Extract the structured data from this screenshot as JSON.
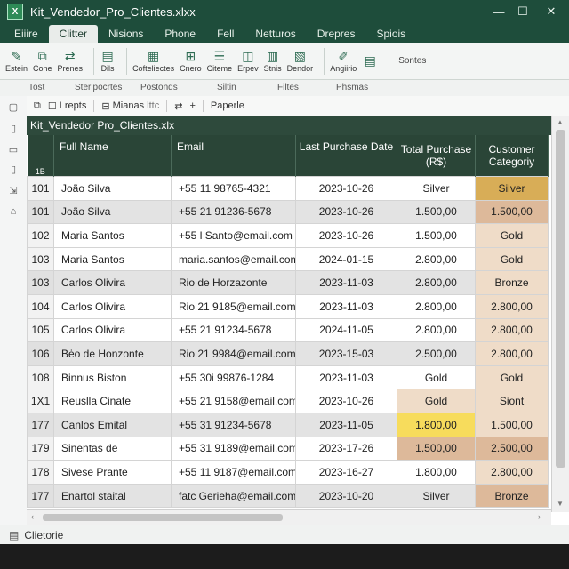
{
  "window": {
    "title": "Kit_Vendedor_Pro_Clientes.xlxx",
    "app_icon_letter": "X",
    "minimize": "—",
    "maximize": "☐",
    "close": "✕"
  },
  "menu_tabs": [
    "Eiiire",
    "Clitter",
    "Nisions",
    "Phone",
    "Fell",
    "Netturos",
    "Drepres",
    "Spiois"
  ],
  "ribbon": {
    "buttons": [
      {
        "label": "Estein",
        "icon": "✎"
      },
      {
        "label": "Cone",
        "icon": "⧉"
      },
      {
        "label": "Prenes",
        "icon": "⇄"
      },
      {
        "label": "Dils",
        "icon": "▤"
      },
      {
        "label": "Cofteliectes",
        "icon": "▦"
      },
      {
        "label": "Cnero",
        "icon": "⊞"
      },
      {
        "label": "Citeme",
        "icon": "☰"
      },
      {
        "label": "Erpev",
        "icon": "◫"
      },
      {
        "label": "Stnis",
        "icon": "▥"
      },
      {
        "label": "Dendor",
        "icon": "▧"
      },
      {
        "label": "Angiirio",
        "icon": "✐"
      },
      {
        "label": "",
        "icon": "▤"
      }
    ],
    "extra_label": "Sontes"
  },
  "ribbon_groups": [
    "Tost",
    "Steripocrtes",
    "Postonds",
    "Siltin",
    "Filtes",
    "Phsmas"
  ],
  "quickbar": {
    "item1": "Lrepts",
    "item2": "Mianas",
    "item2_suffix": "lttc",
    "plus": "+",
    "item3": "Paperle"
  },
  "file_tab": "Kit_Vendedor Pro_Clientes.xlx",
  "table": {
    "corner_label": "1B",
    "headers": [
      "Full Name",
      "Email",
      "Last Purchase Date",
      "Total Purchase (R$)",
      "Customer Categoriy"
    ],
    "rows": [
      {
        "id": "101",
        "name": "João Silva",
        "email": "+55 11 98765-4321",
        "date": "2023-10-26",
        "total": "Silver",
        "category": "Silver"
      },
      {
        "id": "101",
        "name": "João Silva",
        "email": "+55 21 91236-5678",
        "date": "2023-10-26",
        "total": "1.500,00",
        "category": "1.500,00"
      },
      {
        "id": "102",
        "name": "Maria Santos",
        "email": "+55 l Santo@email.com",
        "date": "2023-10-26",
        "total": "1.500,00",
        "category": "Gold"
      },
      {
        "id": "103",
        "name": "Maria Santos",
        "email": "maria.santos@email.com",
        "date": "2024-01-15",
        "total": "2.800,00",
        "category": "Gold"
      },
      {
        "id": "103",
        "name": "Carlos Olivira",
        "email": "Rio de Horzazonte",
        "date": "2023-11-03",
        "total": "2.800,00",
        "category": "Bronze"
      },
      {
        "id": "104",
        "name": "Carlos Olivira",
        "email": "Rio 21 9185@email.com",
        "date": "2023-11-03",
        "total": "2.800,00",
        "category": "2.800,00"
      },
      {
        "id": "105",
        "name": "Carlos Olivira",
        "email": "+55 21 91234-5678",
        "date": "2024-11-05",
        "total": "2.800,00",
        "category": "2.800,00"
      },
      {
        "id": "106",
        "name": "Bėo de Honzonte",
        "email": "Rio 21 9984@email.com",
        "date": "2023-15-03",
        "total": "2.500,00",
        "category": "2.800,00"
      },
      {
        "id": "108",
        "name": "Binnus Biston",
        "email": "+55 30i 99876-1284",
        "date": "2023-11-03",
        "total": "Gold",
        "category": "Gold"
      },
      {
        "id": "1X1",
        "name": "Reuslla Cinate",
        "email": "+55 21 9158@email.com",
        "date": "2023-10-26",
        "total": "Gold",
        "category": "Siont"
      },
      {
        "id": "177",
        "name": "Canlos Emital",
        "email": "+55 31 91234-5678",
        "date": "2023-11-05",
        "total": "1.800,00",
        "category": "1.500,00"
      },
      {
        "id": "179",
        "name": "Sinentas de",
        "email": "+55 31 9189@email.com",
        "date": "2023-17-26",
        "total": "1.500,00",
        "category": "2.500,00"
      },
      {
        "id": "178",
        "name": "Sivese Prante",
        "email": "+55 11 9187@email.com",
        "date": "2023-16-27",
        "total": "1.800,00",
        "category": "2.800,00"
      },
      {
        "id": "177",
        "name": "Enartol staital",
        "email": "fatc Gerieha@email.com",
        "date": "2023-10-20",
        "total": "Silver",
        "category": "Bronze"
      }
    ]
  },
  "colors": {
    "title_bg": "#1e4d3b",
    "header_bg": "#2a4537",
    "tan": "#ddb99a",
    "gold": "#d8ad57",
    "yellow": "#f7dc5c",
    "beige": "#efdcc8"
  },
  "status": {
    "label": "Clietorie"
  }
}
